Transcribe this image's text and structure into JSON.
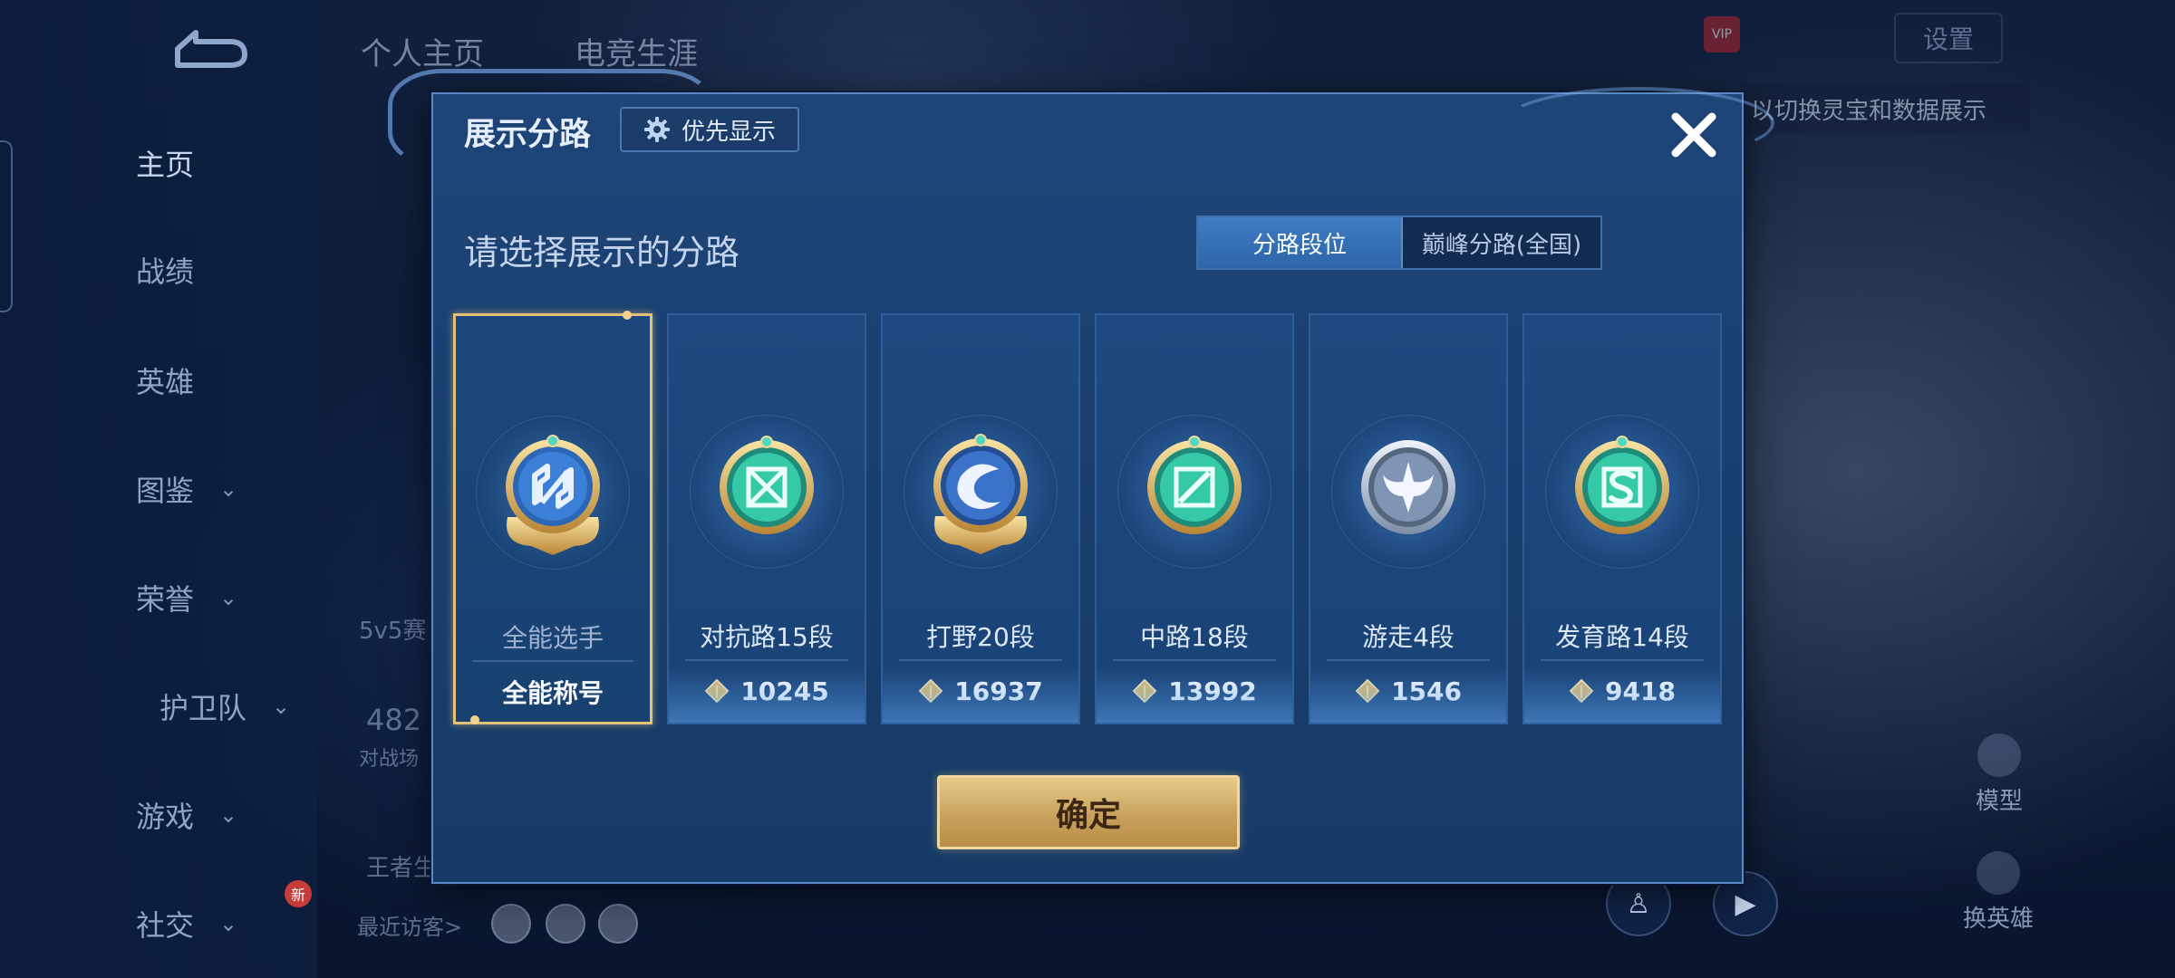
{
  "background": {
    "top_tabs": [
      "个人主页",
      "电竞生涯"
    ],
    "sidebar": [
      {
        "label": "主页",
        "chevron": false,
        "active": true
      },
      {
        "label": "战绩",
        "chevron": false
      },
      {
        "label": "英雄",
        "chevron": false
      },
      {
        "label": "图鉴",
        "chevron": true
      },
      {
        "label": "荣誉",
        "chevron": true
      },
      {
        "label": "护卫队",
        "chevron": true
      },
      {
        "label": "游戏",
        "chevron": true
      },
      {
        "label": "社交",
        "chevron": true,
        "badge": "新"
      }
    ],
    "stats_label": "5v5赛",
    "count_value": "482",
    "count_label": "对战场",
    "king_label": "王者生",
    "recent_visitors": "最近访客>",
    "setting_label": "设置",
    "vip_label": "VIP",
    "hint_text": "以切换灵宝和数据展示",
    "model_label": "模型",
    "swap_hero_label": "换英雄"
  },
  "modal": {
    "title": "展示分路",
    "priority_button": "优先显示",
    "subtitle": "请选择展示的分路",
    "segments": [
      "分路段位",
      "巅峰分路(全国)"
    ],
    "active_segment": 0,
    "cards": [
      {
        "name": "全能选手",
        "footer": "全能称号",
        "selected": true,
        "emblem": "allround",
        "accent": "#3c7fd6"
      },
      {
        "name": "对抗路15段",
        "score": "10245",
        "emblem": "clash",
        "accent": "#35c9a8"
      },
      {
        "name": "打野20段",
        "score": "16937",
        "emblem": "jungle",
        "accent": "#3a73c9"
      },
      {
        "name": "中路18段",
        "score": "13992",
        "emblem": "mid",
        "accent": "#35c9a8"
      },
      {
        "name": "游走4段",
        "score": "1546",
        "emblem": "roam",
        "accent": "#7f95b3"
      },
      {
        "name": "发育路14段",
        "score": "9418",
        "emblem": "farm",
        "accent": "#35c9a8"
      }
    ],
    "confirm": "确定"
  }
}
